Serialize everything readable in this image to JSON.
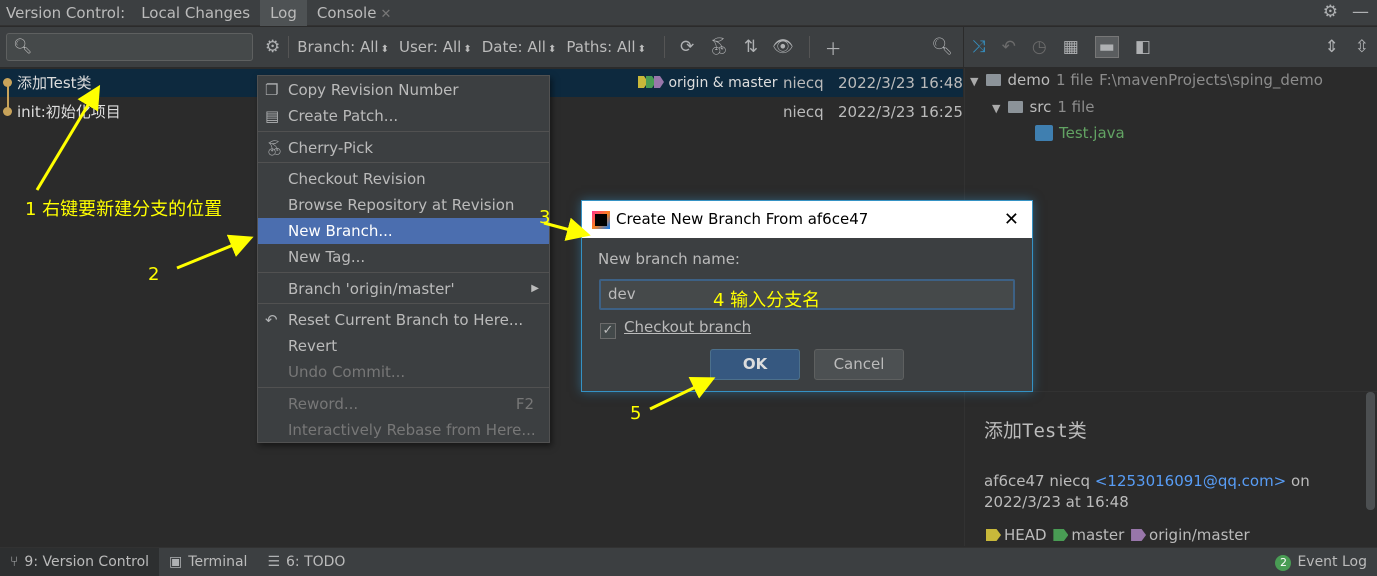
{
  "topbar": {
    "title": "Version Control:",
    "tabs": [
      {
        "label": "Local Changes"
      },
      {
        "label": "Log"
      },
      {
        "label": "Console"
      }
    ]
  },
  "toolbar": {
    "search_placeholder": "",
    "filters": [
      {
        "label": "Branch: All"
      },
      {
        "label": "User: All"
      },
      {
        "label": "Date: All"
      },
      {
        "label": "Paths: All"
      }
    ]
  },
  "commits": [
    {
      "message": "添加Test类",
      "refs": "origin & master",
      "author": "niecq",
      "date": "2022/3/23 16:48",
      "selected": true
    },
    {
      "message": "init:初始化项目",
      "refs": "",
      "author": "niecq",
      "date": "2022/3/23 16:25",
      "selected": false
    }
  ],
  "context_menu": {
    "items": [
      {
        "label": "Copy Revision Number",
        "icon": "copy-icon"
      },
      {
        "label": "Create Patch...",
        "icon": "patch-icon"
      },
      {
        "label": "Cherry-Pick",
        "icon": "cherry-icon"
      },
      {
        "label": "Checkout Revision"
      },
      {
        "label": "Browse Repository at Revision"
      },
      {
        "label": "New Branch..."
      },
      {
        "label": "New Tag..."
      },
      {
        "label": "Branch 'origin/master'"
      },
      {
        "label": "Reset Current Branch to Here...",
        "icon": "undo-icon"
      },
      {
        "label": "Revert"
      },
      {
        "label": "Undo Commit..."
      },
      {
        "label": "Reword...",
        "shortcut": "F2"
      },
      {
        "label": "Interactively Rebase from Here..."
      }
    ]
  },
  "dialog": {
    "title": "Create New Branch From af6ce47",
    "label": "New branch name:",
    "value": "dev",
    "checkbox_label": "Checkout branch",
    "checkbox_checked": true,
    "ok_label": "OK",
    "cancel_label": "Cancel"
  },
  "changes_tree": {
    "root": {
      "name": "demo",
      "count": "1 file",
      "path": "F:\\mavenProjects\\sping_demo"
    },
    "folder": {
      "name": "src",
      "count": "1 file"
    },
    "file": {
      "name": "Test.java"
    }
  },
  "commit_detail": {
    "subject": "添加Test类",
    "hash": "af6ce47",
    "author": "niecq",
    "email": "<1253016091@qq.com>",
    "on": "on",
    "date": "2022/3/23 at 16:48",
    "refs": [
      "HEAD",
      "master",
      "origin/master"
    ]
  },
  "statusbar": {
    "items": [
      {
        "label": "9: Version Control"
      },
      {
        "label": "Terminal"
      },
      {
        "label": "6: TODO"
      }
    ],
    "event_log": "Event Log",
    "event_count": "2"
  },
  "annotations": {
    "a1": "1 右键要新建分支的位置",
    "a2": "2",
    "a3": "3",
    "a4": "4 输入分支名",
    "a5": "5"
  },
  "colors": {
    "background": "#2b2b2b",
    "panel": "#3c3f41",
    "selection": "#0d293e",
    "menu_highlight": "#4b6eaf",
    "annotation": "#ffff00",
    "link": "#589df6"
  }
}
